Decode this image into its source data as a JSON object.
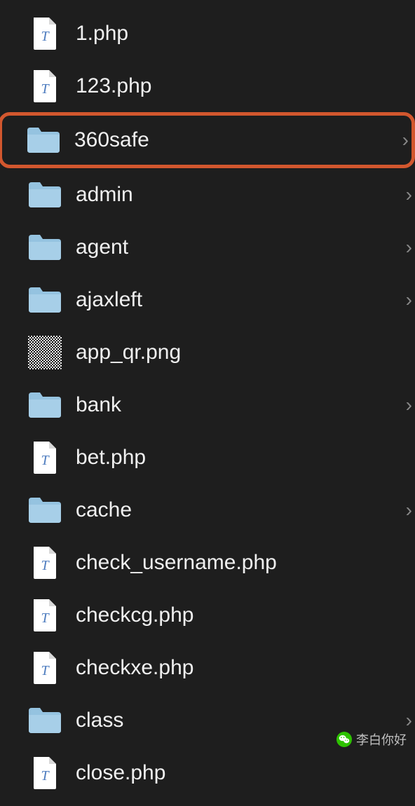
{
  "files": [
    {
      "name": "1.php",
      "type": "php",
      "chevron": false,
      "highlighted": false
    },
    {
      "name": "123.php",
      "type": "php",
      "chevron": false,
      "highlighted": false
    },
    {
      "name": "360safe",
      "type": "folder",
      "chevron": true,
      "highlighted": true
    },
    {
      "name": "admin",
      "type": "folder",
      "chevron": true,
      "highlighted": false
    },
    {
      "name": "agent",
      "type": "folder",
      "chevron": true,
      "highlighted": false
    },
    {
      "name": "ajaxleft",
      "type": "folder",
      "chevron": true,
      "highlighted": false
    },
    {
      "name": "app_qr.png",
      "type": "png",
      "chevron": false,
      "highlighted": false
    },
    {
      "name": "bank",
      "type": "folder",
      "chevron": true,
      "highlighted": false
    },
    {
      "name": "bet.php",
      "type": "php",
      "chevron": false,
      "highlighted": false
    },
    {
      "name": "cache",
      "type": "folder",
      "chevron": true,
      "highlighted": false
    },
    {
      "name": "check_username.php",
      "type": "php",
      "chevron": false,
      "highlighted": false
    },
    {
      "name": "checkcg.php",
      "type": "php",
      "chevron": false,
      "highlighted": false
    },
    {
      "name": "checkxe.php",
      "type": "php",
      "chevron": false,
      "highlighted": false
    },
    {
      "name": "class",
      "type": "folder",
      "chevron": true,
      "highlighted": false
    },
    {
      "name": "close.php",
      "type": "php",
      "chevron": false,
      "highlighted": false
    }
  ],
  "watermark": {
    "text": "李白你好"
  }
}
